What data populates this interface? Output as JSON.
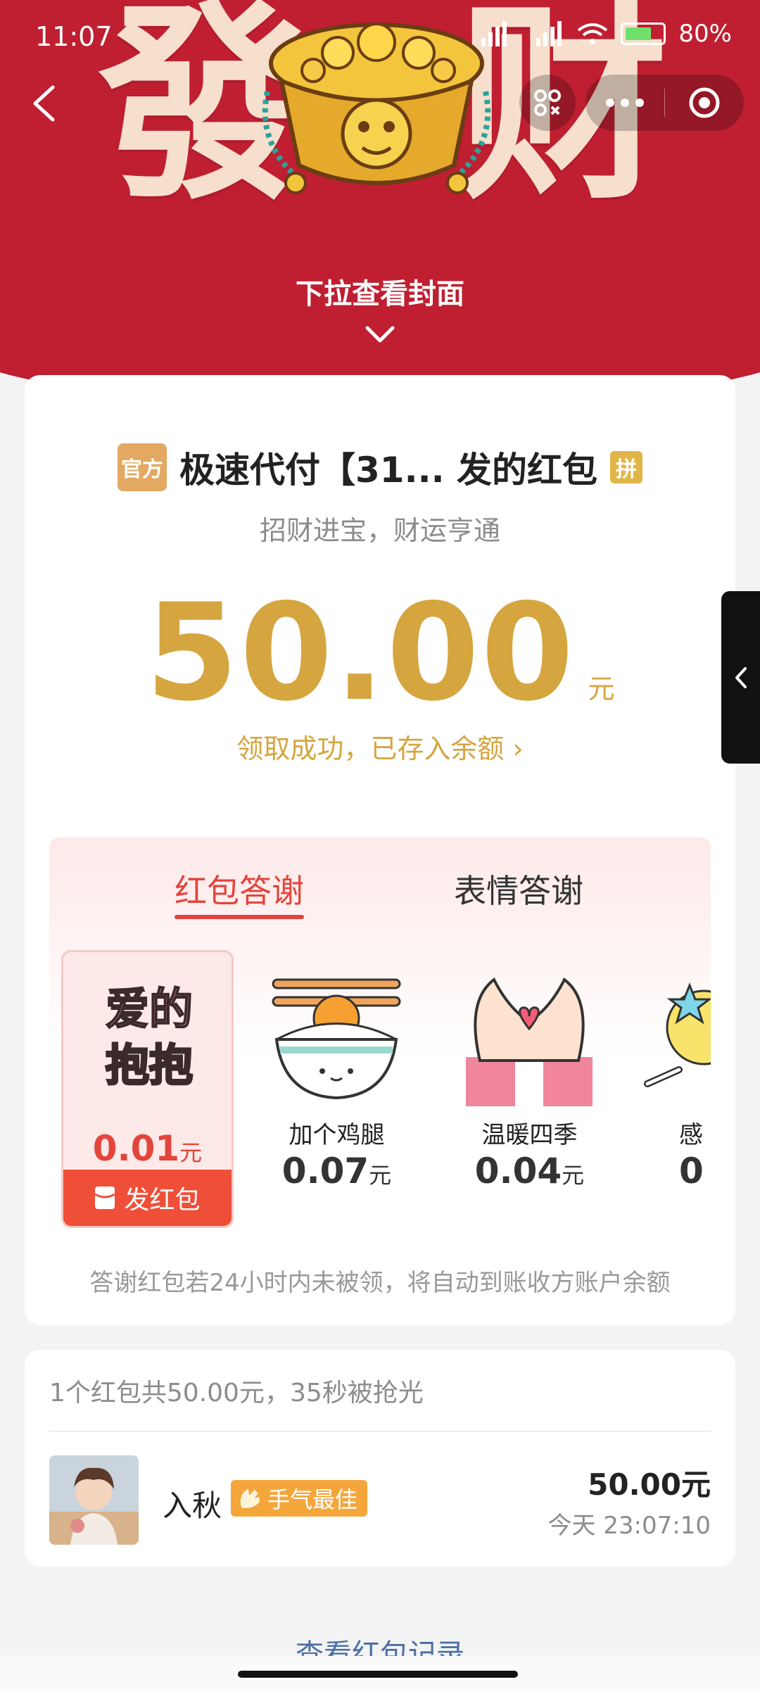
{
  "status_bar": {
    "time": "11:07",
    "battery": "80%",
    "icons": [
      "notification-icon",
      "signal-icon",
      "wifi-icon",
      "battery-icon"
    ]
  },
  "header": {
    "cover_left_char": "發",
    "cover_right_char": "财",
    "pull_hint": "下拉查看封面"
  },
  "red_packet": {
    "official_badge": "官方",
    "sender": "极速代付【31... 发的红包",
    "pin_badge": "拼",
    "greeting": "招财进宝，财运亨通",
    "amount": "50.00",
    "unit": "元",
    "received_text": "领取成功，已存入余额",
    "received_chevron": "›"
  },
  "thanks": {
    "tabs": [
      {
        "label": "红包答谢",
        "active": true
      },
      {
        "label": "表情答谢",
        "active": false
      }
    ],
    "gifts": [
      {
        "art_text_1": "爱的",
        "art_text_2": "抱抱",
        "price": "0.01",
        "unit": "元",
        "action": "发红包"
      },
      {
        "name": "加个鸡腿",
        "price": "0.07",
        "unit": "元"
      },
      {
        "name": "温暖四季",
        "price": "0.04",
        "unit": "元"
      },
      {
        "name": "感",
        "price": "0"
      }
    ],
    "note": "答谢红包若24小时内未被领，将自动到账收方账户余额"
  },
  "records": {
    "summary": "1个红包共50.00元，35秒被抢光",
    "items": [
      {
        "name": "入秋",
        "badge": "手气最佳",
        "amount": "50.00元",
        "time": "今天 23:07:10"
      }
    ],
    "view_all": "查看红包记录"
  },
  "colors": {
    "header_red": "#bf1f31",
    "gold": "#d5a53f",
    "accent_red": "#e3453d",
    "send_button": "#ef4f38",
    "best_badge": "#f5a63b",
    "link_blue": "#4a6fa5"
  }
}
